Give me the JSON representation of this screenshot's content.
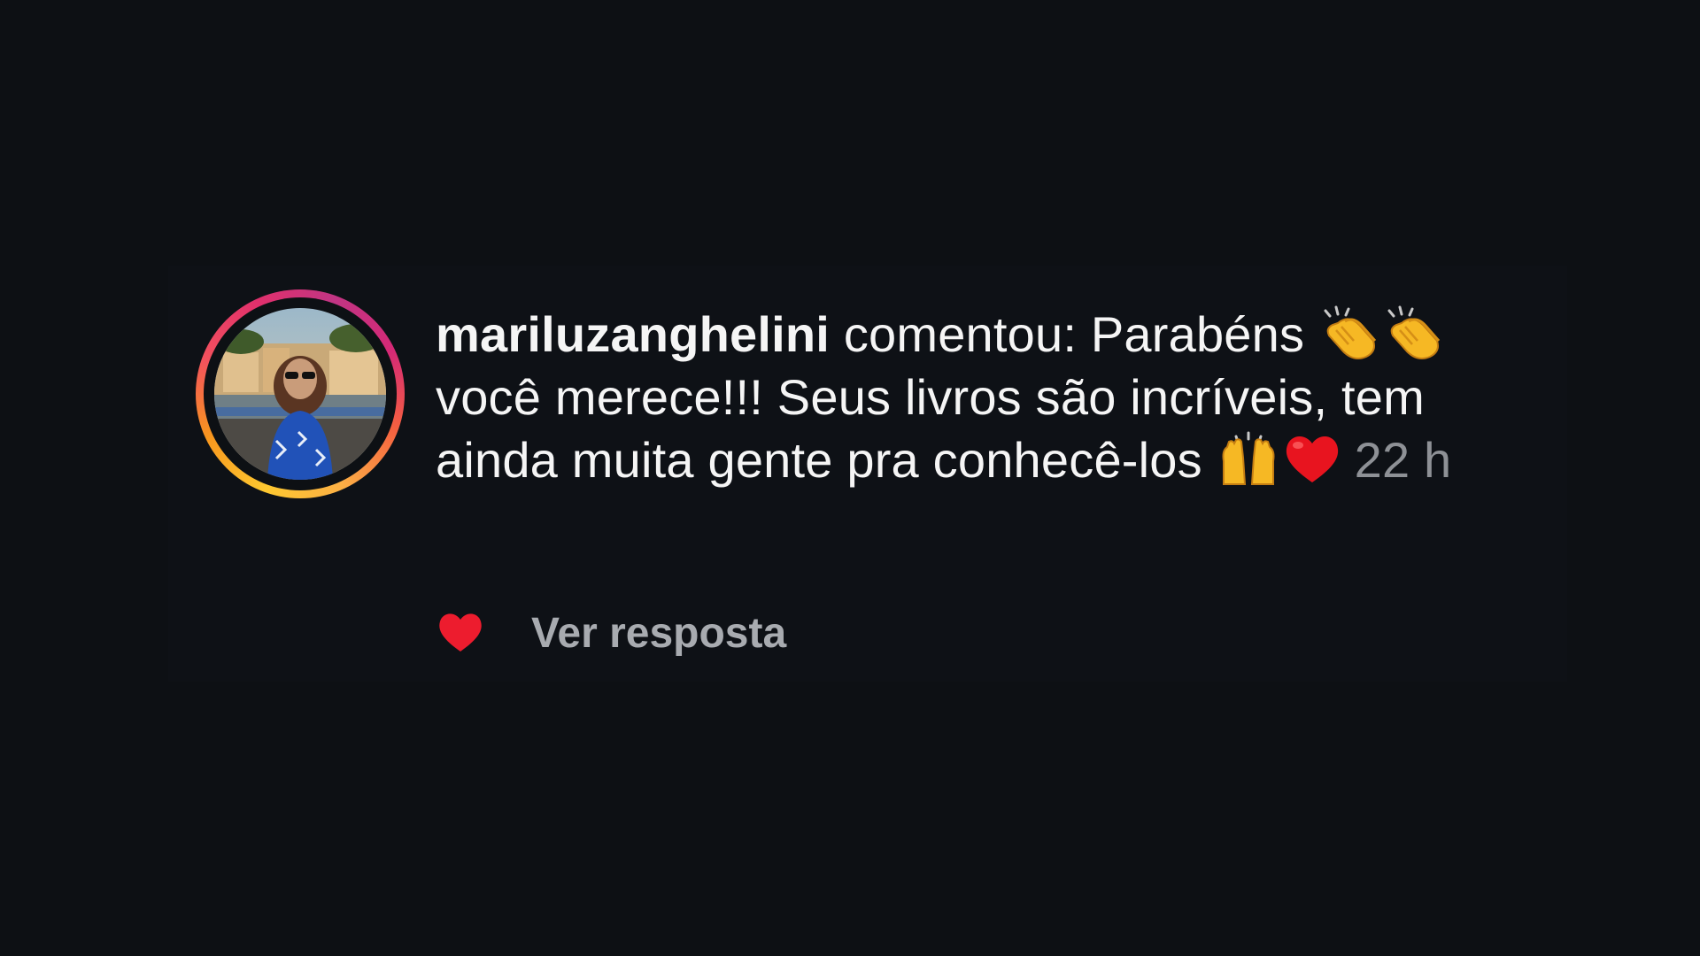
{
  "notification": {
    "username": "mariluzanghelini",
    "segments": {
      "verb_text": " comentou: Parabéns ",
      "after_clap": " você merece!!! Seus livros são incríveis, tem ainda muita gente pra conhecê-los "
    },
    "timestamp": "22 h",
    "emojis": [
      "clapping-hands",
      "clapping-hands",
      "raising-hands",
      "red-heart"
    ]
  },
  "actions": {
    "reply_label": "Ver resposta",
    "like_state": "liked",
    "like_color": "#ed1c2e"
  },
  "colors": {
    "background": "#0d1014",
    "text": "#f5f5f5",
    "muted": "#8e9196",
    "avatar_ring": [
      "#fdc830",
      "#f56040",
      "#e1306c",
      "#c13584"
    ]
  }
}
